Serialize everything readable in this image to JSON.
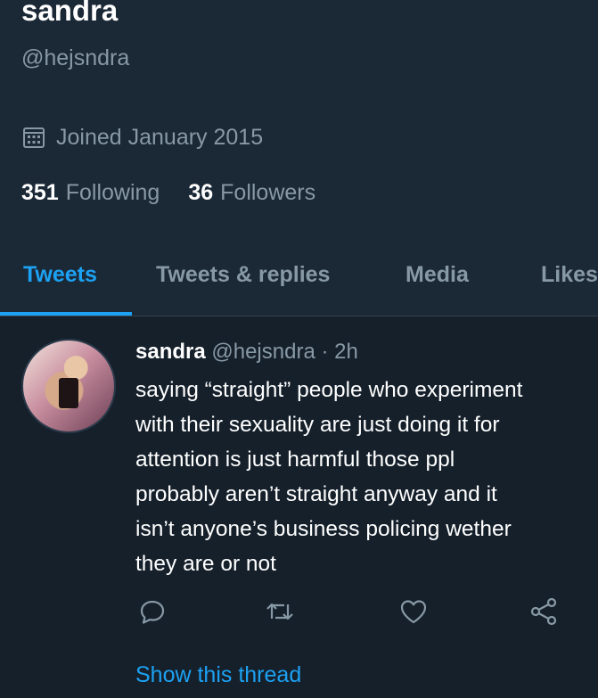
{
  "profile": {
    "name": "sandra",
    "handle": "@hejsndra",
    "joined": "Joined January 2015",
    "following_count": "351",
    "following_label": "Following",
    "followers_count": "36",
    "followers_label": "Followers"
  },
  "tabs": [
    {
      "label": "Tweets",
      "active": true
    },
    {
      "label": "Tweets & replies",
      "active": false
    },
    {
      "label": "Media",
      "active": false
    },
    {
      "label": "Likes",
      "active": false
    }
  ],
  "tweet": {
    "author_name": "sandra",
    "meta": "@hejsndra · 2h",
    "lines": [
      "saying “straight” people who experiment",
      "with their sexuality are just doing it for",
      "attention is just harmful those ppl",
      "probably aren’t straight anyway and it",
      "isn’t anyone’s business policing wether",
      "they are or not"
    ],
    "show_thread": "Show this thread"
  },
  "icons": {
    "calendar": "calendar-icon",
    "reply": "reply-icon",
    "retweet": "retweet-icon",
    "like": "heart-icon",
    "share": "share-icon"
  },
  "colors": {
    "background": "#1b2836",
    "tweet_background": "#15202b",
    "accent": "#1da1f2",
    "secondary_text": "#8899a6"
  }
}
